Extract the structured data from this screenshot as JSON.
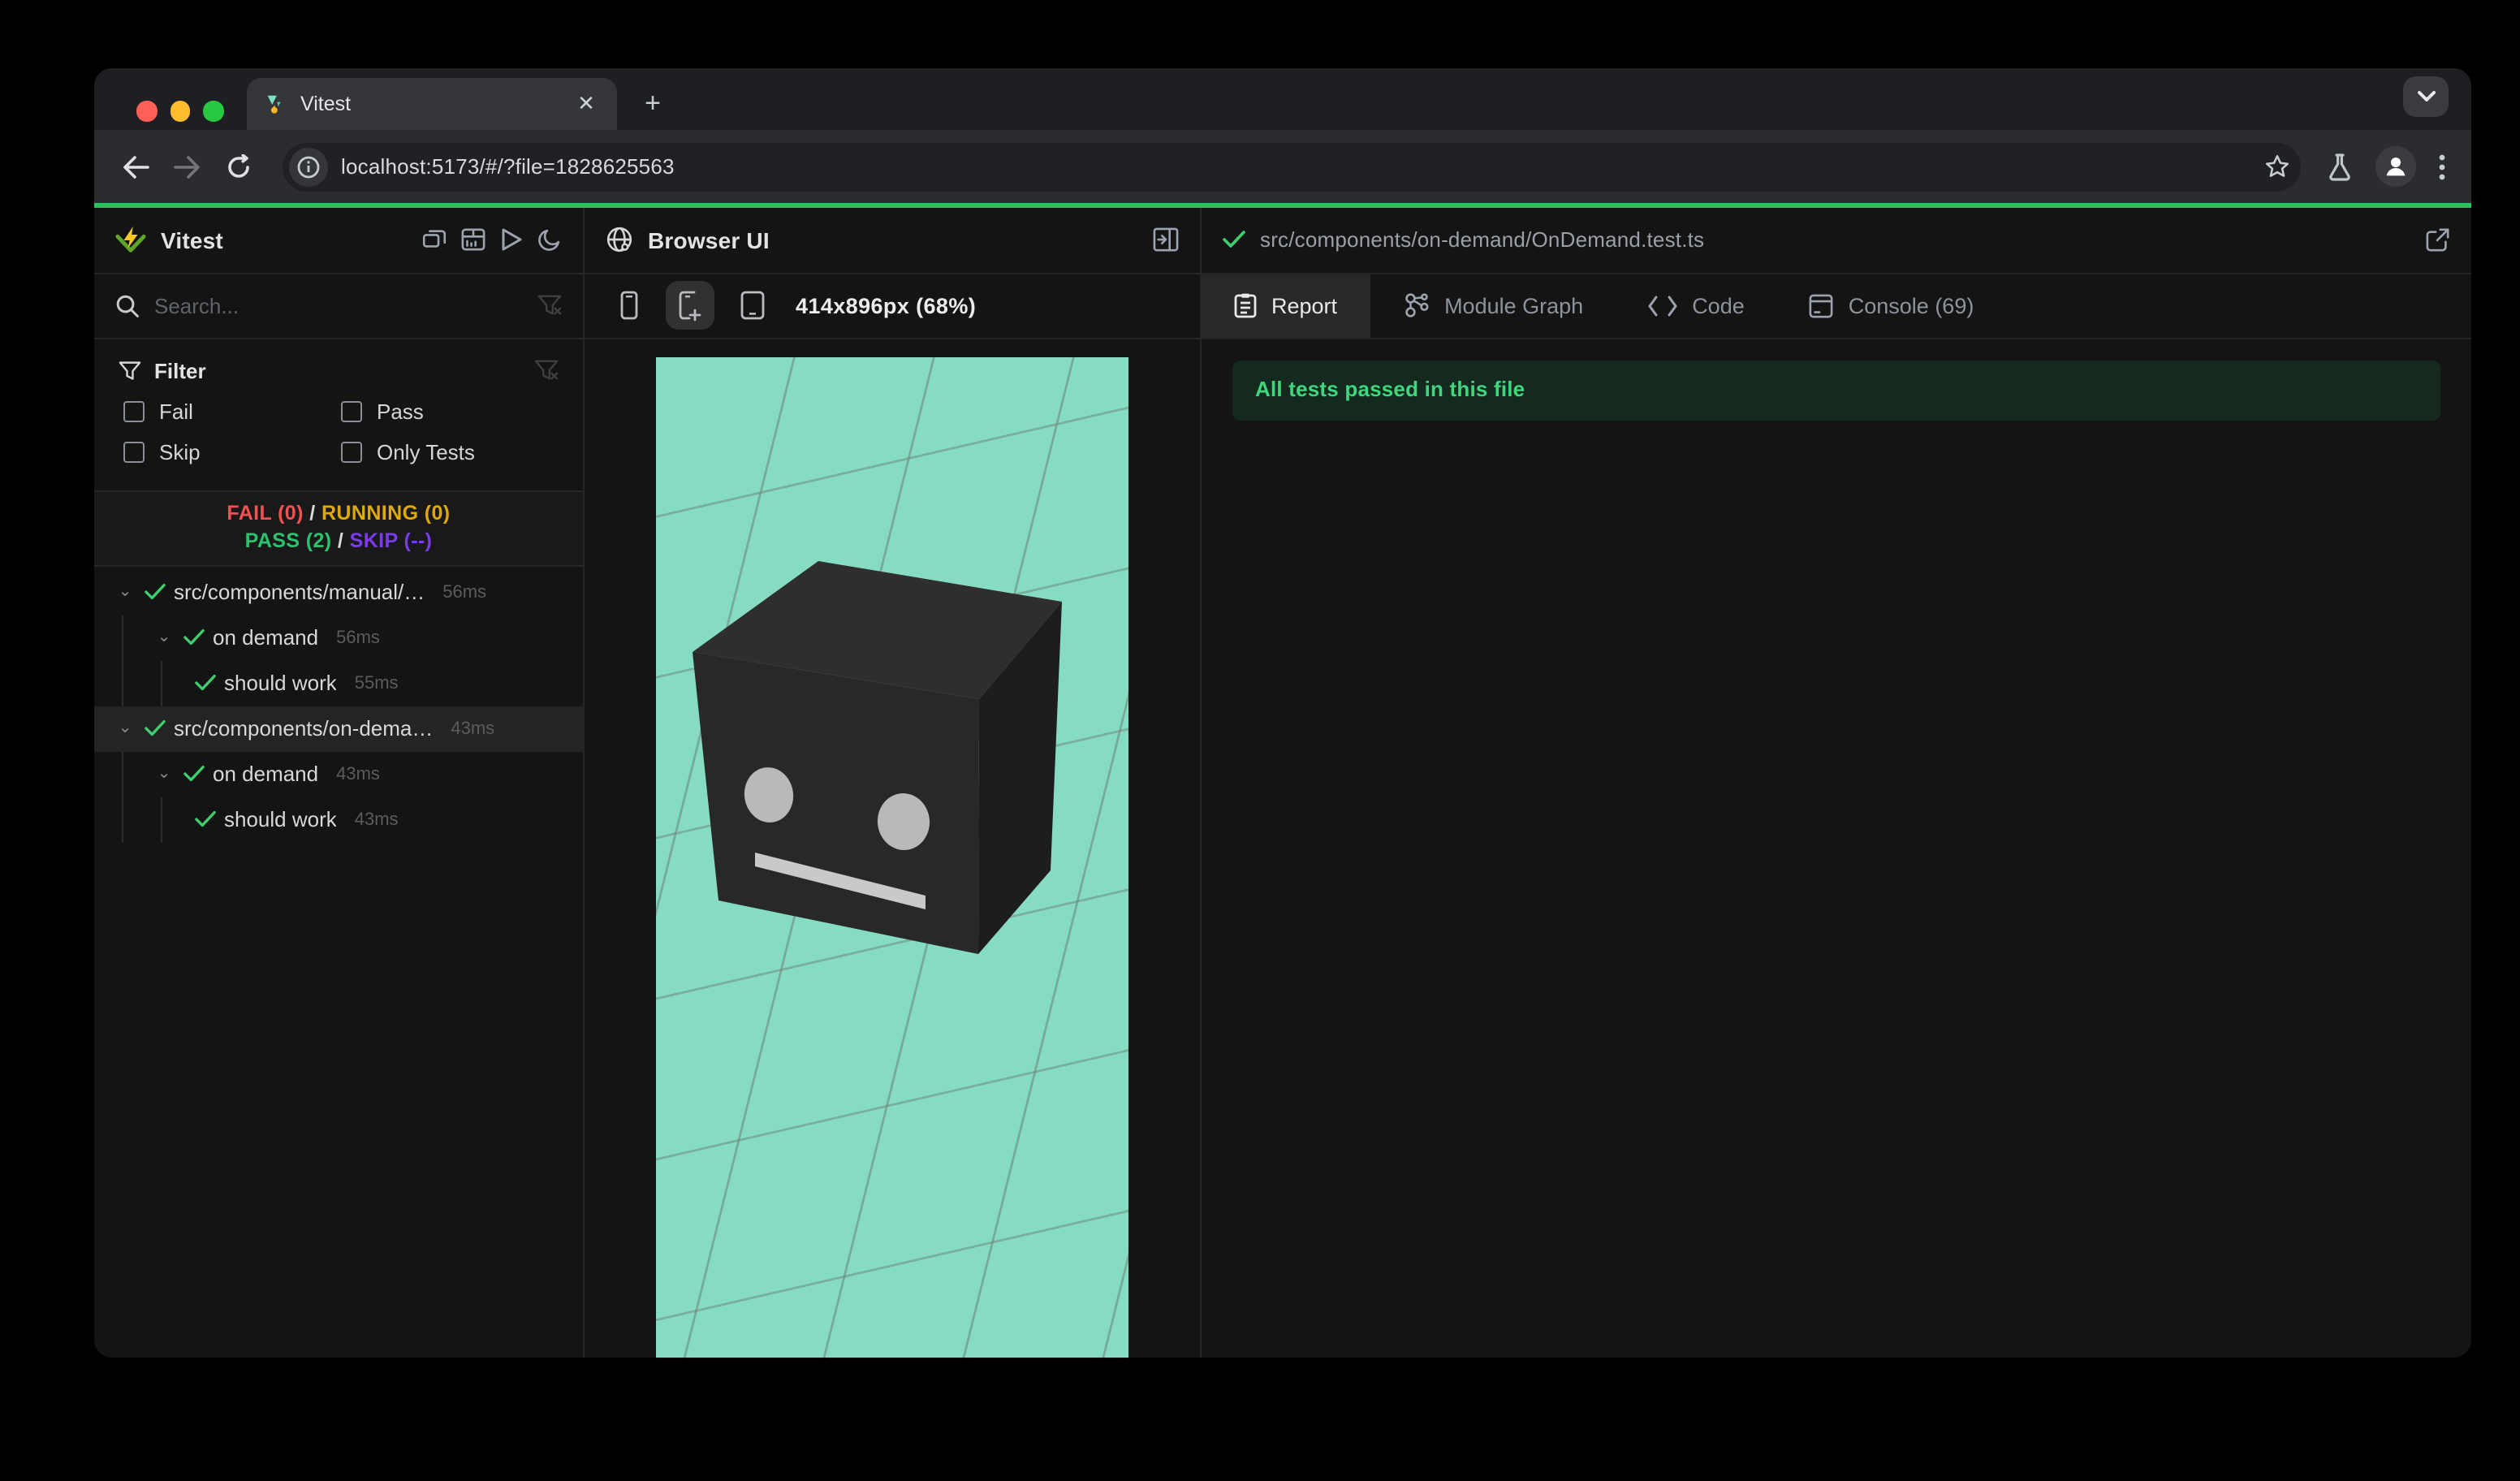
{
  "browser": {
    "tab_title": "Vitest",
    "close_glyph": "✕",
    "newtab_glyph": "+",
    "url": "localhost:5173/#/?file=1828625563"
  },
  "sidebar": {
    "app_name": "Vitest",
    "search_placeholder": "Search...",
    "filter": {
      "title": "Filter",
      "options": [
        "Fail",
        "Pass",
        "Skip",
        "Only Tests"
      ]
    },
    "summary": {
      "fail": "FAIL (0)",
      "running": "RUNNING (0)",
      "pass": "PASS (2)",
      "skip": "SKIP (--)",
      "sep": "/"
    },
    "tree": [
      {
        "label": "src/components/manual/…",
        "time": "56ms",
        "level": 0,
        "chevron": true,
        "selected": false
      },
      {
        "label": "on demand",
        "time": "56ms",
        "level": 1,
        "chevron": true,
        "selected": false
      },
      {
        "label": "should work",
        "time": "55ms",
        "level": 2,
        "chevron": false,
        "selected": false
      },
      {
        "label": "src/components/on-dema…",
        "time": "43ms",
        "level": 0,
        "chevron": true,
        "selected": true
      },
      {
        "label": "on demand",
        "time": "43ms",
        "level": 1,
        "chevron": true,
        "selected": false
      },
      {
        "label": "should work",
        "time": "43ms",
        "level": 2,
        "chevron": false,
        "selected": false
      }
    ]
  },
  "preview": {
    "title": "Browser UI",
    "size_label": "414x896px (68%)",
    "devices": [
      "small",
      "medium",
      "large"
    ],
    "active_device": 1
  },
  "report": {
    "file_path": "src/components/on-demand/OnDemand.test.ts",
    "tabs": [
      {
        "label": "Report",
        "icon": "report-icon",
        "active": true
      },
      {
        "label": "Module Graph",
        "icon": "module-graph-icon",
        "active": false
      },
      {
        "label": "Code",
        "icon": "code-icon",
        "active": false
      },
      {
        "label": "Console (69)",
        "icon": "console-icon",
        "active": false
      }
    ],
    "banner": "All tests passed in this file"
  },
  "colors": {
    "accent_green": "#23c55e",
    "fail_red": "#f05252",
    "running_yellow": "#dfa80b",
    "pass_green": "#2bc26e",
    "skip_purple": "#7c3aed",
    "viewport_teal": "#85dcc3",
    "banner_bg": "#152a1e",
    "banner_text": "#3fd67e"
  }
}
